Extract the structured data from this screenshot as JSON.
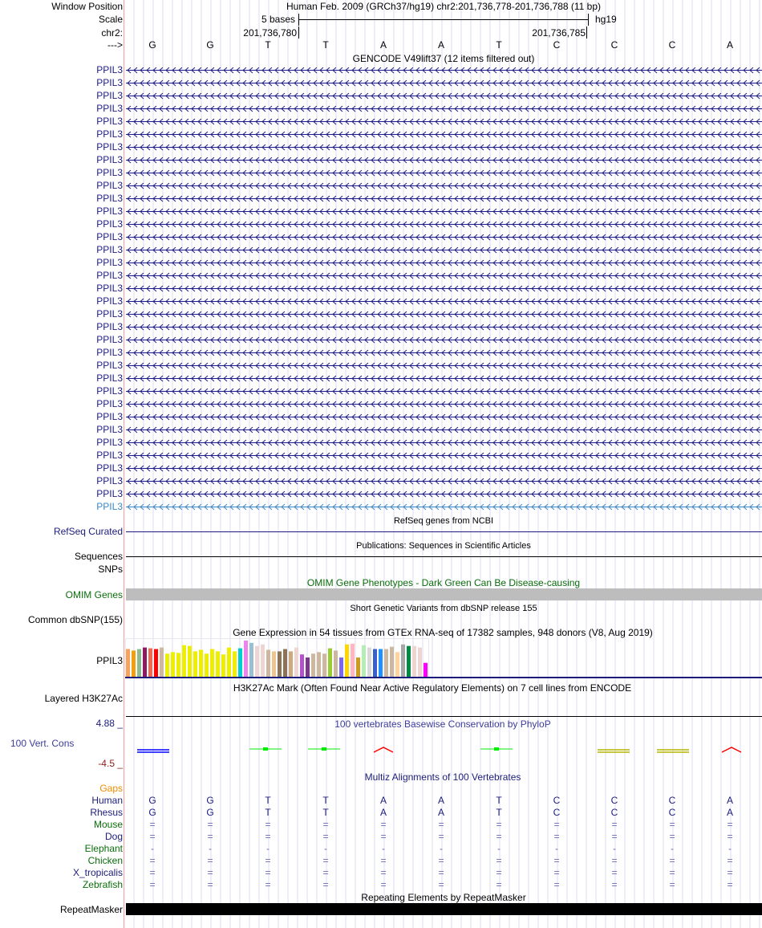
{
  "header": {
    "window_position_label": "Window Position",
    "window_position": "Human Feb. 2009 (GRCh37/hg19)   chr2:201,736,778-201,736,788 (11 bp)",
    "scale_label": "Scale",
    "scale_text": "5 bases",
    "assembly": "hg19",
    "chrom_label": "chr2:",
    "pos_left": "201,736,780",
    "pos_right": "201,736,785",
    "strand_label": "--->"
  },
  "bases": [
    "G",
    "G",
    "T",
    "T",
    "A",
    "A",
    "T",
    "C",
    "C",
    "C",
    "A"
  ],
  "gencode": {
    "title": "GENCODE V49lift37 (12 items filtered out)",
    "gene": "PPIL3",
    "rows": 35,
    "color": "#1c1c8c",
    "last_color": "#3a87c8"
  },
  "refseq": {
    "title": "RefSeq genes from NCBI",
    "label": "RefSeq Curated"
  },
  "pubs": {
    "title": "Publications: Sequences in Scientific Articles",
    "label": "Sequences"
  },
  "snps": {
    "label": "SNPs"
  },
  "omim": {
    "title": "OMIM Gene Phenotypes - Dark Green Can Be Disease-causing",
    "label": "OMIM Genes"
  },
  "dbsnp": {
    "title": "Short Genetic Variants from dbSNP release 155",
    "label": "Common dbSNP(155)"
  },
  "gtex": {
    "title": "Gene Expression in 54 tissues from GTEx RNA-seq of 17382 samples, 948 donors (V8, Aug 2019)",
    "label": "PPIL3"
  },
  "h3k27ac": {
    "title": "H3K27Ac Mark (Often Found Near Active Regulatory Elements) on 7 cell lines from ENCODE",
    "label": "Layered H3K27Ac"
  },
  "phylop": {
    "title": "100 vertebrates Basewise Conservation by PhyloP",
    "label": "100 Vert. Cons",
    "max": "4.88 _",
    "min": "-4.5 _"
  },
  "multiz": {
    "title": "Multiz Alignments of 100 Vertebrates",
    "gaps_label": "Gaps",
    "species": [
      {
        "name": "Human",
        "color": "#1c1c7c",
        "row": [
          "G",
          "G",
          "T",
          "T",
          "A",
          "A",
          "T",
          "C",
          "C",
          "C",
          "A"
        ]
      },
      {
        "name": "Rhesus",
        "color": "#1c1c7c",
        "row": [
          "G",
          "G",
          "T",
          "T",
          "A",
          "A",
          "T",
          "C",
          "C",
          "C",
          "A"
        ]
      },
      {
        "name": "Mouse",
        "color": "#0a6e0a",
        "row": [
          "=",
          "=",
          "=",
          "=",
          "=",
          "=",
          "=",
          "=",
          "=",
          "=",
          "="
        ]
      },
      {
        "name": "Dog",
        "color": "#1c1c7c",
        "row": [
          "=",
          "=",
          "=",
          "=",
          "=",
          "=",
          "=",
          "=",
          "=",
          "=",
          "="
        ]
      },
      {
        "name": "Elephant",
        "color": "#0a6e0a",
        "row": [
          "-",
          "-",
          "-",
          "-",
          "-",
          "-",
          "-",
          "-",
          "-",
          "-",
          "-"
        ]
      },
      {
        "name": "Chicken",
        "color": "#0a6e0a",
        "row": [
          "=",
          "=",
          "=",
          "=",
          "=",
          "=",
          "=",
          "=",
          "=",
          "=",
          "="
        ]
      },
      {
        "name": "X_tropicalis",
        "color": "#1c1c7c",
        "row": [
          "=",
          "=",
          "=",
          "=",
          "=",
          "=",
          "=",
          "=",
          "=",
          "=",
          "="
        ]
      },
      {
        "name": "Zebrafish",
        "color": "#0a6e0a",
        "row": [
          "=",
          "=",
          "=",
          "=",
          "=",
          "=",
          "=",
          "=",
          "=",
          "=",
          "="
        ]
      }
    ]
  },
  "repeatmasker": {
    "title": "Repeating Elements by RepeatMasker",
    "label": "RepeatMasker"
  },
  "chart_data": {
    "type": "bar",
    "title": "Gene Expression in 54 tissues from GTEx RNA-seq of 17382 samples, 948 donors (V8, Aug 2019)",
    "values": [
      36,
      34,
      36,
      38,
      37,
      36,
      38,
      30,
      32,
      31,
      41,
      40,
      33,
      35,
      30,
      36,
      33,
      29,
      38,
      33,
      37,
      47,
      44,
      40,
      42,
      35,
      33,
      33,
      36,
      33,
      38,
      29,
      25,
      30,
      32,
      30,
      37,
      34,
      25,
      42,
      43,
      25,
      41,
      38,
      36,
      36,
      36,
      39,
      32,
      42,
      40,
      40,
      38,
      18
    ],
    "colors": [
      "#f9a25c",
      "#f0a00f",
      "#8fbc8f",
      "#8b1c62",
      "#ee6a50",
      "#ff0000",
      "#cdb79e",
      "#eeee00",
      "#eeee00",
      "#eeee00",
      "#eeee00",
      "#eeee00",
      "#eeee00",
      "#eeee00",
      "#eeee00",
      "#eeee00",
      "#eeee00",
      "#eeee00",
      "#eeee00",
      "#eeee00",
      "#00ced1",
      "#ee82ee",
      "#9ac0cd",
      "#eed5d2",
      "#eed5d2",
      "#cdb79e",
      "#eec591",
      "#8b7355",
      "#8b7355",
      "#cdaa7d",
      "#eed5d2",
      "#b452cd",
      "#7a378b",
      "#cdb79e",
      "#cdb79e",
      "#cdb79e",
      "#9acd32",
      "#cdb79e",
      "#7b68ee",
      "#ffd700",
      "#ffb6c1",
      "#cd9b1d",
      "#b4eeb4",
      "#d9d9d9",
      "#3a5fcd",
      "#1e90ff",
      "#cdb79e",
      "#cdb79e",
      "#ffd39b",
      "#a6a6a6",
      "#008b45",
      "#eed5d2",
      "#eed5d2",
      "#ff00ff"
    ]
  },
  "phylop_glyph_colors": [
    "#0000ff",
    "",
    "",
    "#00ee00",
    "#00ee00",
    "#ff0000",
    "",
    "#00ee00",
    "",
    "#b5b500",
    "#b5b500",
    "#ff0000"
  ]
}
